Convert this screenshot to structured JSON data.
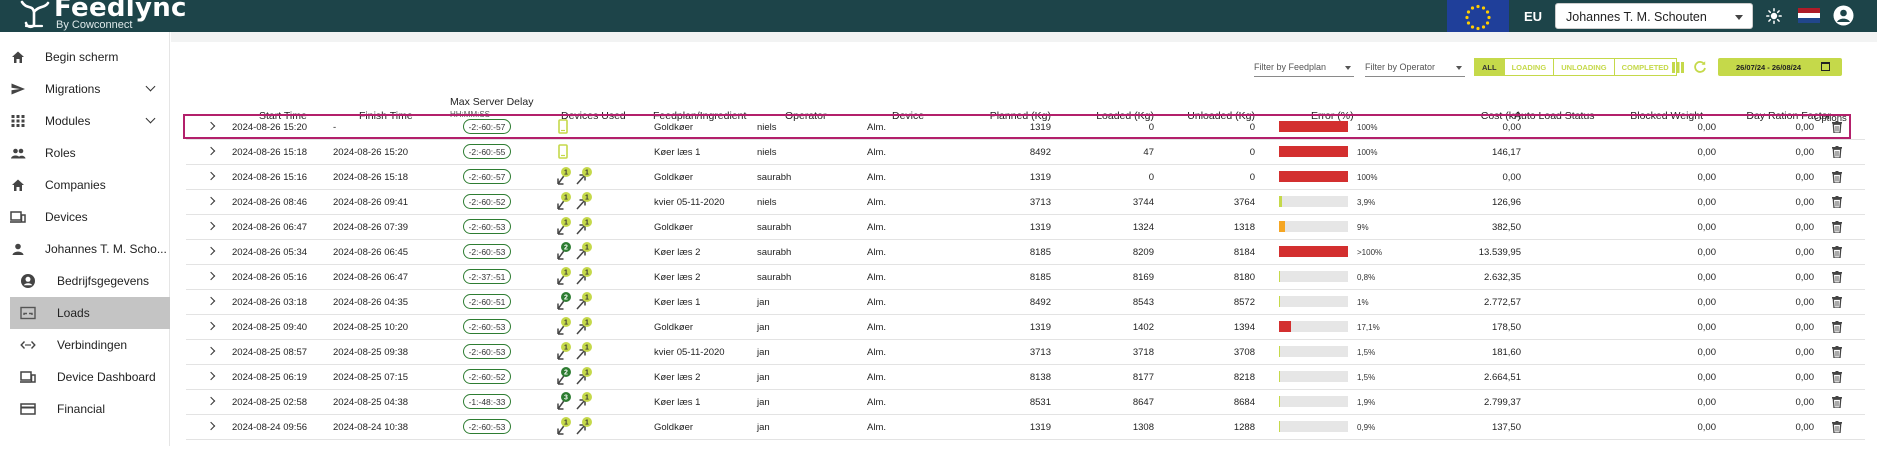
{
  "app": {
    "name": "Feedlync",
    "byline": "By Cowconnect",
    "region": "EU",
    "user": "Johannes T. M. Schouten"
  },
  "colors": {
    "topbar": "#1d4449",
    "accent": "#c5d94a",
    "error_red": "#d32f2f",
    "error_orange": "#f5a623",
    "selected_row_border": "#b3206b"
  },
  "sidebar": {
    "items": [
      {
        "label": "Begin scherm",
        "icon": "home-icon"
      },
      {
        "label": "Migrations",
        "icon": "send-icon",
        "expandable": true
      },
      {
        "label": "Modules",
        "icon": "grid-icon",
        "expandable": true
      },
      {
        "label": "Roles",
        "icon": "people-icon"
      },
      {
        "label": "Companies",
        "icon": "home-icon"
      },
      {
        "label": "Devices",
        "icon": "devices-icon"
      },
      {
        "label": "Johannes T. M. Scho...",
        "icon": "person-icon"
      }
    ],
    "subitems": [
      {
        "label": "Bedrijfsgegevens",
        "icon": "account-circle-icon"
      },
      {
        "label": "Loads",
        "icon": "scale-icon",
        "active": true
      },
      {
        "label": "Verbindingen",
        "icon": "code-icon"
      },
      {
        "label": "Device Dashboard",
        "icon": "devices-icon"
      },
      {
        "label": "Financial",
        "icon": "card-icon"
      }
    ]
  },
  "filters": {
    "feedplan_placeholder": "Filter by Feedplan",
    "operator_placeholder": "Filter by Operator"
  },
  "status_tabs": [
    "ALL",
    "LOADING",
    "UNLOADING",
    "COMPLETED"
  ],
  "date_range": "26/07/24 - 26/08/24",
  "columns": {
    "start": "Start Time",
    "finish": "Finish Time",
    "delay": "Max Server Delay",
    "delay_sub": "HH:MM:SS",
    "devices": "Devices Used",
    "feedplan": "Feedplan/Ingredient",
    "operator": "Operator",
    "device": "Device",
    "planned": "Planned (Kg)",
    "loaded": "Loaded (Kg)",
    "unloaded": "Unloaded (Kg)",
    "error": "Error (%)",
    "cost": "Cost (kr)",
    "auto": "Auto Load Status",
    "blocked": "Blocked Weight",
    "ration": "Day Ration Factor",
    "options": "Options"
  },
  "rows": [
    {
      "start": "2024-08-26 15:20",
      "finish": "-",
      "delay": "-2:-60:-57",
      "devices": "phone",
      "badge1": "",
      "badge2": "",
      "feedplan": "Goldkøer",
      "operator": "niels",
      "device": "Alm.",
      "planned": "1319",
      "loaded": "0",
      "unloaded": "0",
      "error_pct": 100,
      "error": "100%",
      "cost": "0,00",
      "blocked": "0,00",
      "ration": "0,00"
    },
    {
      "start": "2024-08-26 15:18",
      "finish": "2024-08-26 15:20",
      "delay": "-2:-60:-55",
      "devices": "phone",
      "badge1": "",
      "badge2": "",
      "feedplan": "Køer læs 1",
      "operator": "niels",
      "device": "Alm.",
      "planned": "8492",
      "loaded": "47",
      "unloaded": "0",
      "error_pct": 100,
      "error": "100%",
      "cost": "146,17",
      "blocked": "0,00",
      "ration": "0,00"
    },
    {
      "start": "2024-08-26 15:16",
      "finish": "2024-08-26 15:18",
      "delay": "-2:-60:-57",
      "devices": "arrows",
      "badge1": "1",
      "badge2": "1",
      "feedplan": "Goldkøer",
      "operator": "saurabh",
      "device": "Alm.",
      "planned": "1319",
      "loaded": "0",
      "unloaded": "0",
      "error_pct": 100,
      "error": "100%",
      "cost": "0,00",
      "blocked": "0,00",
      "ration": "0,00"
    },
    {
      "start": "2024-08-26 08:46",
      "finish": "2024-08-26 09:41",
      "delay": "-2:-60:-52",
      "devices": "arrows",
      "badge1": "1",
      "badge2": "1",
      "feedplan": "kvier 05-11-2020",
      "operator": "niels",
      "device": "Alm.",
      "planned": "3713",
      "loaded": "3744",
      "unloaded": "3764",
      "error_pct": 3.9,
      "error": "3,9%",
      "cost": "126,96",
      "blocked": "0,00",
      "ration": "0,00"
    },
    {
      "start": "2024-08-26 06:47",
      "finish": "2024-08-26 07:39",
      "delay": "-2:-60:-53",
      "devices": "arrows",
      "badge1": "1",
      "badge2": "1",
      "feedplan": "Goldkøer",
      "operator": "saurabh",
      "device": "Alm.",
      "planned": "1319",
      "loaded": "1324",
      "unloaded": "1318",
      "error_pct": 9,
      "error": "9%",
      "cost": "382,50",
      "blocked": "0,00",
      "ration": "0,00"
    },
    {
      "start": "2024-08-26 05:34",
      "finish": "2024-08-26 06:45",
      "delay": "-2:-60:-53",
      "devices": "arrows",
      "badge1": "2",
      "badge2": "1",
      "feedplan": "Køer læs 2",
      "operator": "saurabh",
      "device": "Alm.",
      "planned": "8185",
      "loaded": "8209",
      "unloaded": "8184",
      "error_pct": 100,
      "error": ">100%",
      "cost": "13.539,95",
      "blocked": "0,00",
      "ration": "0,00"
    },
    {
      "start": "2024-08-26 05:16",
      "finish": "2024-08-26 06:47",
      "delay": "-2:-37:-51",
      "devices": "arrows",
      "badge1": "1",
      "badge2": "1",
      "feedplan": "Køer læs 2",
      "operator": "saurabh",
      "device": "Alm.",
      "planned": "8185",
      "loaded": "8169",
      "unloaded": "8180",
      "error_pct": 0.8,
      "error": "0,8%",
      "cost": "2.632,35",
      "blocked": "0,00",
      "ration": "0,00"
    },
    {
      "start": "2024-08-26 03:18",
      "finish": "2024-08-26 04:35",
      "delay": "-2:-60:-51",
      "devices": "arrows",
      "badge1": "2",
      "badge2": "1",
      "feedplan": "Køer læs 1",
      "operator": "jan",
      "device": "Alm.",
      "planned": "8492",
      "loaded": "8543",
      "unloaded": "8572",
      "error_pct": 1,
      "error": "1%",
      "cost": "2.772,57",
      "blocked": "0,00",
      "ration": "0,00"
    },
    {
      "start": "2024-08-25 09:40",
      "finish": "2024-08-25 10:20",
      "delay": "-2:-60:-53",
      "devices": "arrows",
      "badge1": "1",
      "badge2": "1",
      "feedplan": "Goldkøer",
      "operator": "jan",
      "device": "Alm.",
      "planned": "1319",
      "loaded": "1402",
      "unloaded": "1394",
      "error_pct": 17.1,
      "error": "17,1%",
      "cost": "178,50",
      "blocked": "0,00",
      "ration": "0,00"
    },
    {
      "start": "2024-08-25 08:57",
      "finish": "2024-08-25 09:38",
      "delay": "-2:-60:-53",
      "devices": "arrows",
      "badge1": "1",
      "badge2": "1",
      "feedplan": "kvier 05-11-2020",
      "operator": "jan",
      "device": "Alm.",
      "planned": "3713",
      "loaded": "3718",
      "unloaded": "3708",
      "error_pct": 1.5,
      "error": "1,5%",
      "cost": "181,60",
      "blocked": "0,00",
      "ration": "0,00"
    },
    {
      "start": "2024-08-25 06:19",
      "finish": "2024-08-25 07:15",
      "delay": "-2:-60:-52",
      "devices": "arrows",
      "badge1": "2",
      "badge2": "1",
      "feedplan": "Køer læs 2",
      "operator": "jan",
      "device": "Alm.",
      "planned": "8138",
      "loaded": "8177",
      "unloaded": "8218",
      "error_pct": 1.5,
      "error": "1,5%",
      "cost": "2.664,51",
      "blocked": "0,00",
      "ration": "0,00"
    },
    {
      "start": "2024-08-25 02:58",
      "finish": "2024-08-25 04:38",
      "delay": "-1:-48:-33",
      "devices": "arrows",
      "badge1": "3",
      "badge2": "1",
      "feedplan": "Køer læs 1",
      "operator": "jan",
      "device": "Alm.",
      "planned": "8531",
      "loaded": "8647",
      "unloaded": "8684",
      "error_pct": 1.9,
      "error": "1,9%",
      "cost": "2.799,37",
      "blocked": "0,00",
      "ration": "0,00"
    },
    {
      "start": "2024-08-24 09:56",
      "finish": "2024-08-24 10:38",
      "delay": "-2:-60:-53",
      "devices": "arrows",
      "badge1": "1",
      "badge2": "1",
      "feedplan": "Goldkøer",
      "operator": "jan",
      "device": "Alm.",
      "planned": "1319",
      "loaded": "1308",
      "unloaded": "1288",
      "error_pct": 0.9,
      "error": "0,9%",
      "cost": "137,50",
      "blocked": "0,00",
      "ration": "0,00"
    }
  ]
}
